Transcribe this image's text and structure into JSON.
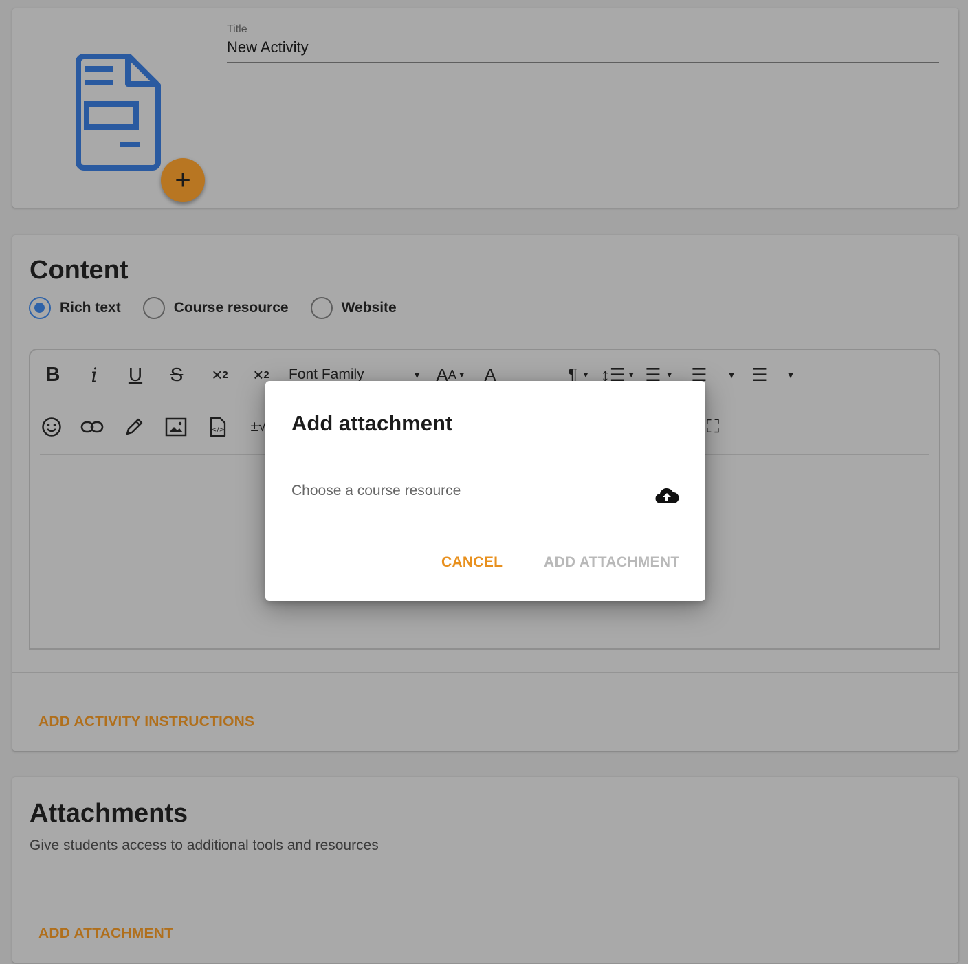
{
  "header": {
    "title_label": "Title",
    "title_value": "New Activity",
    "add_fab": "+"
  },
  "content": {
    "heading": "Content",
    "options": [
      {
        "label": "Rich text",
        "checked": true
      },
      {
        "label": "Course resource",
        "checked": false
      },
      {
        "label": "Website",
        "checked": false
      }
    ],
    "toolbar": {
      "font_family": "Font Family"
    },
    "add_instructions": "ADD ACTIVITY INSTRUCTIONS"
  },
  "attachments": {
    "heading": "Attachments",
    "subtitle": "Give students access to additional tools and resources",
    "add_button": "ADD ATTACHMENT"
  },
  "dialog": {
    "title": "Add attachment",
    "placeholder": "Choose a course resource",
    "cancel": "CANCEL",
    "confirm": "ADD ATTACHMENT",
    "upload_icon": "cloud-upload-icon"
  },
  "colors": {
    "accent": "#e8901e",
    "accent_dimmed": "#b06f1c",
    "primary": "#2e62a8",
    "overlay_bg": "#a3a3a3"
  }
}
